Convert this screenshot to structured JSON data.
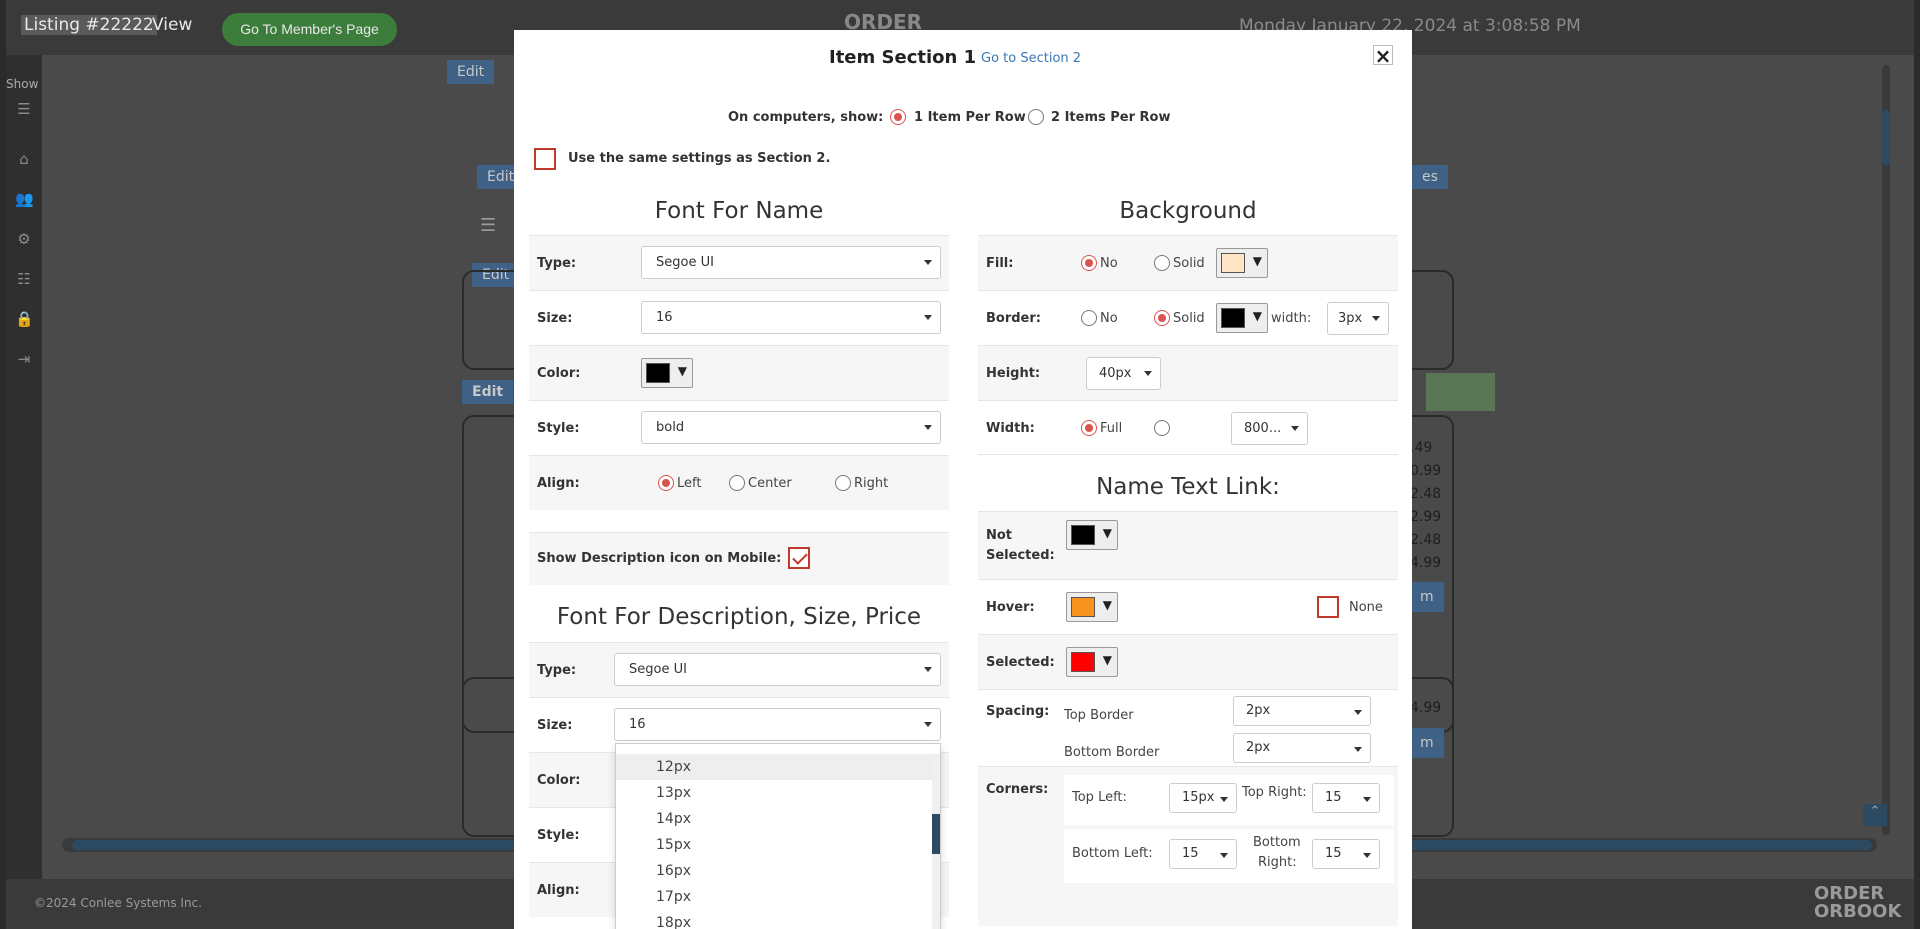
{
  "topbar": {
    "listing": "Listing #22222",
    "view": "View",
    "member_button": "Go To Member's Page",
    "logo": "ORDER",
    "datetime": "Monday January 22, 2024 at 3:08:58 PM"
  },
  "left_rail": {
    "show": "Show"
  },
  "workspace": {
    "edit": "Edit",
    "prices": [
      ".49",
      "0.99",
      "2.48",
      "2.99",
      "2.48",
      "4.99",
      "4.99"
    ],
    "m": "m",
    "es": "es"
  },
  "footer": {
    "copyright": "©2024 Conlee Systems Inc.",
    "logo_top": "ORDER",
    "logo_bottom": "ORBOOK"
  },
  "modal": {
    "title": "Item Section 1",
    "goto": "Go to Section 2",
    "close": "×",
    "computers_label": "On computers, show:",
    "one_per_row": "1 Item Per Row",
    "two_per_row": "2 Items Per Row",
    "same_settings": "Use the same settings as Section 2.",
    "font_name": {
      "heading": "Font For Name",
      "type_label": "Type:",
      "type_value": "Segoe UI",
      "size_label": "Size:",
      "size_value": "16",
      "color_label": "Color:",
      "color": "#000000",
      "style_label": "Style:",
      "style_value": "bold",
      "align_label": "Align:",
      "align_left": "Left",
      "align_center": "Center",
      "align_right": "Right"
    },
    "show_desc_label": "Show Description icon on Mobile:",
    "font_desc": {
      "heading": "Font For Description, Size, Price",
      "type_label": "Type:",
      "type_value": "Segoe UI",
      "size_label": "Size:",
      "size_value": "16",
      "color_label": "Color:",
      "style_label": "Style:",
      "align_label": "Align:"
    },
    "size_options": [
      "12px",
      "13px",
      "14px",
      "15px",
      "16px",
      "17px",
      "18px"
    ],
    "background": {
      "heading": "Background",
      "fill_label": "Fill:",
      "no": "No",
      "solid": "Solid",
      "fill_color": "#fde5c6",
      "border_label": "Border:",
      "border_color": "#000000",
      "width_label": "width:",
      "width_value": "3px",
      "height_label": "Height:",
      "height_value": "40px",
      "width_row_label": "Width:",
      "full": "Full",
      "width_custom": "800..."
    },
    "name_link": {
      "heading": "Name Text Link:",
      "not_selected_label_1": "Not",
      "not_selected_label_2": "Selected:",
      "not_selected_color": "#000000",
      "hover_label": "Hover:",
      "hover_color": "#f7931e",
      "none": "None",
      "selected_label": "Selected:",
      "selected_color": "#ff0000",
      "spacing_label": "Spacing:",
      "top_border": "Top Border",
      "top_border_value": "2px",
      "bottom_border": "Bottom Border",
      "bottom_border_value": "2px",
      "corners_label": "Corners:",
      "top_left": "Top Left:",
      "top_left_value": "15px",
      "top_right": "Top Right:",
      "top_right_value": "15",
      "bottom_left": "Bottom Left:",
      "bottom_left_value": "15",
      "bottom_right_1": "Bottom",
      "bottom_right_2": "Right:",
      "bottom_right_value": "15"
    }
  }
}
